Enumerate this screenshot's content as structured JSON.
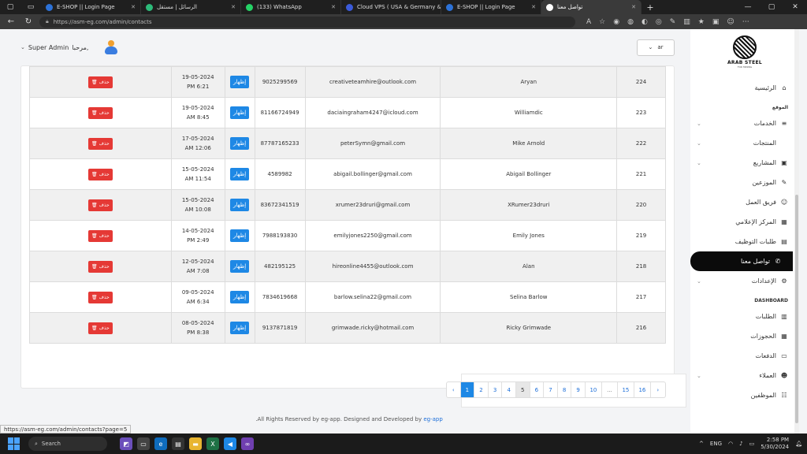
{
  "browser": {
    "tabs": [
      {
        "title": "E-SHOP || Login Page",
        "color": "#2c72d8",
        "active": false
      },
      {
        "title": "الرسائل | مستقل",
        "color": "#2dbb7a",
        "active": false
      },
      {
        "title": "(133) WhatsApp",
        "color": "#25d366",
        "active": false
      },
      {
        "title": "Cloud VPS ( USA & Germany & F",
        "color": "#3b5bdb",
        "active": false
      },
      {
        "title": "E-SHOP || Login Page",
        "color": "#2c72d8",
        "active": false
      },
      {
        "title": "تواصل معنا",
        "color": "#ffffff",
        "active": true
      }
    ],
    "url": "https://asm-eg.com/admin/contacts",
    "status_url": "https://asm-eg.com/admin/contacts?page=5"
  },
  "topbar": {
    "user_name": "Super Admin",
    "greeting": "مرحبا,",
    "lang_label": "ar"
  },
  "sidebar": {
    "logo_text": "ARAB STEEL",
    "logo_sub": "FOR MINING",
    "home": "الرئيسية",
    "section_site": "الموقع",
    "section_dashboard": "DASHBOARD",
    "items": [
      {
        "label": "الخدمات",
        "icon": "≡",
        "chevron": true
      },
      {
        "label": "المنتجات",
        "icon": "",
        "chevron": true
      },
      {
        "label": "المشاريع",
        "icon": "▣",
        "chevron": true
      },
      {
        "label": "الموزعين",
        "icon": "✎",
        "chevron": false
      },
      {
        "label": "فريق العمل",
        "icon": "☺",
        "chevron": false
      },
      {
        "label": "المركز الإعلامي",
        "icon": "▦",
        "chevron": false
      },
      {
        "label": "طلبات التوظيف",
        "icon": "▤",
        "chevron": false
      },
      {
        "label": "تواصل معنا",
        "icon": "✆",
        "chevron": false,
        "active": true
      },
      {
        "label": "الإعدادات",
        "icon": "⚙",
        "chevron": true
      }
    ],
    "dashboard_items": [
      {
        "label": "الطلبات",
        "icon": "▥"
      },
      {
        "label": "الحجوزات",
        "icon": "▦"
      },
      {
        "label": "الدفعات",
        "icon": "▭"
      },
      {
        "label": "العملاء",
        "icon": "☻",
        "chevron": true
      },
      {
        "label": "الموظفين",
        "icon": "☷"
      }
    ]
  },
  "table": {
    "show_label": "إظهار",
    "delete_label": "حذف",
    "rows": [
      {
        "id": "224",
        "name": "Aryan",
        "email": "creativeteamhire@outlook.com",
        "phone": "9025299569",
        "date": "19-05-2024",
        "time": "PM 6:21"
      },
      {
        "id": "223",
        "name": "Williamdic",
        "email": "daciaingraham4247@icloud.com",
        "phone": "81166724949",
        "date": "19-05-2024",
        "time": "AM 8:45"
      },
      {
        "id": "222",
        "name": "Mike Arnold",
        "email": "peterSymn@gmail.com",
        "phone": "87787165233",
        "date": "17-05-2024",
        "time": "AM 12:06"
      },
      {
        "id": "221",
        "name": "Abigail Bollinger",
        "email": "abigail.bollinger@gmail.com",
        "phone": "4589982",
        "date": "15-05-2024",
        "time": "AM 11:54"
      },
      {
        "id": "220",
        "name": "XRumer23druri",
        "email": "xrumer23druri@gmail.com",
        "phone": "83672341519",
        "date": "15-05-2024",
        "time": "AM 10:08"
      },
      {
        "id": "219",
        "name": "Emily Jones",
        "email": "emilyjones2250@gmail.com",
        "phone": "7988193830",
        "date": "14-05-2024",
        "time": "PM 2:49"
      },
      {
        "id": "218",
        "name": "Alan",
        "email": "hireonline4455@outlook.com",
        "phone": "482195125",
        "date": "12-05-2024",
        "time": "AM 7:08"
      },
      {
        "id": "217",
        "name": "Selina Barlow",
        "email": "barlow.selina22@gmail.com",
        "phone": "7834619668",
        "date": "09-05-2024",
        "time": "AM 6:34"
      },
      {
        "id": "216",
        "name": "Ricky Grimwade",
        "email": "grimwade.ricky@hotmail.com",
        "phone": "9137871819",
        "date": "08-05-2024",
        "time": "PM 8:38"
      }
    ]
  },
  "pagination": {
    "items": [
      "‹",
      "1",
      "2",
      "3",
      "4",
      "5",
      "6",
      "7",
      "8",
      "9",
      "10",
      "...",
      "15",
      "16",
      "›"
    ],
    "current": "1",
    "highlighted": "5"
  },
  "footer": {
    "text": ".All Rights Reserved by eg-app. Designed and Developed by",
    "link": "eg-app"
  },
  "taskbar": {
    "search": "Search",
    "lang": "ENG",
    "time": "2:58 PM",
    "date": "5/30/2024"
  }
}
